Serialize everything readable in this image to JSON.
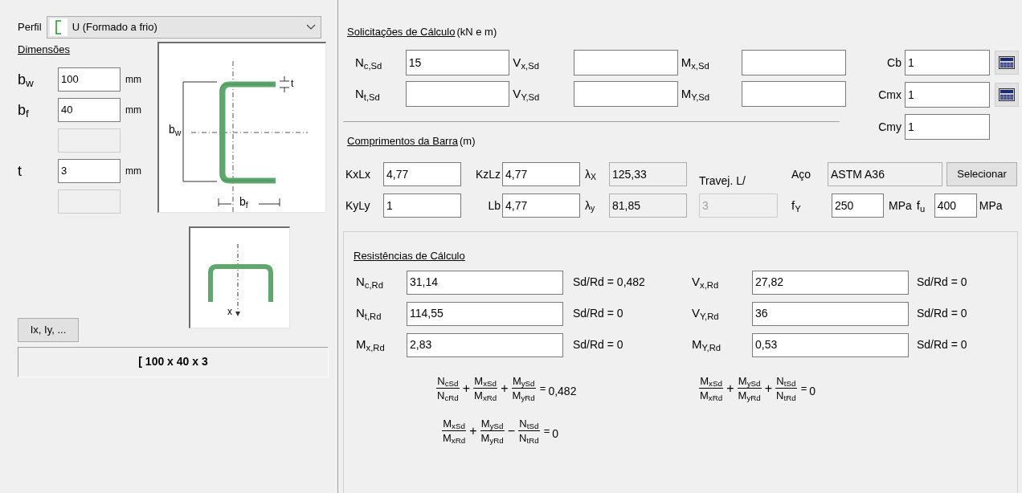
{
  "profile": {
    "label": "Perfil",
    "value": "U (Formado a frio)"
  },
  "dimensions": {
    "title": "Dimensões",
    "rows": [
      {
        "kind": "input",
        "label": "b$_{w}$",
        "value": "100",
        "unit": "mm"
      },
      {
        "kind": "input",
        "label": "b$_{f}$",
        "value": "40",
        "unit": "mm"
      },
      {
        "kind": "disabled"
      },
      {
        "kind": "input",
        "label": "t",
        "value": "3",
        "unit": "mm"
      },
      {
        "kind": "disabled"
      }
    ]
  },
  "section_drawing": {
    "web_label": "b$_{w}$",
    "flange_label": "b$_{f}$",
    "thickness_label": "t"
  },
  "axis_drawing": {
    "axis_label": "x"
  },
  "properties_button": "Ix, Iy, ...",
  "designation": "[ 100 x 40 x 3",
  "loads": {
    "title": "Solicitações de Cálculo",
    "unit_note": "(kN e m)",
    "rows": [
      [
        {
          "label": "N$_{c,Sd}$",
          "kind": "input",
          "value": "15"
        },
        {
          "label": "V$_{x,Sd}$",
          "kind": "input"
        },
        {
          "label": "M$_{x,Sd}$",
          "kind": "input"
        }
      ],
      [
        {
          "label": "N$_{t,Sd}$",
          "kind": "input"
        },
        {
          "label": "V$_{Y,Sd}$",
          "kind": "input"
        },
        {
          "label": "M$_{Y,Sd}$",
          "kind": "input"
        }
      ]
    ]
  },
  "coefficients": [
    {
      "label": "Cb",
      "kind": "input",
      "value": "1",
      "calculator": true
    },
    {
      "label": "Cmx",
      "kind": "input",
      "value": "1",
      "calculator": true
    },
    {
      "label": "Cmy",
      "kind": "input",
      "value": "1",
      "calculator": false
    }
  ],
  "lengths": {
    "title": "Comprimentos da Barra",
    "unit_note": "(m)",
    "rows": [
      [
        {
          "label": "KxLx",
          "kind": "input",
          "value": "4,77"
        },
        {
          "label": "KzLz",
          "kind": "input",
          "value": "4,77"
        },
        {
          "label": "λ$_{X}$",
          "kind": "readonly",
          "value": "125,33"
        }
      ],
      [
        {
          "label": "KyLy",
          "kind": "input",
          "value": "1"
        },
        {
          "label": "Lb",
          "kind": "input",
          "value": "4,77"
        },
        {
          "label": "λ$_{y}$",
          "kind": "readonly",
          "value": "81,85"
        }
      ]
    ],
    "bracing": {
      "label": "Travej. L/",
      "kind": "disabled",
      "value": "3"
    }
  },
  "material": {
    "steel_label": "Aço",
    "steel": {
      "kind": "readonly",
      "value": "ASTM A36"
    },
    "select_button": "Selecionar",
    "fy": {
      "label": "f$_{Y}$",
      "kind": "input",
      "value": "250",
      "unit": "MPa"
    },
    "fu": {
      "label": "f$_{u}$",
      "kind": "input",
      "value": "400",
      "unit": "MPa"
    }
  },
  "resistances": {
    "title": "Resistências de Cálculo",
    "rows": [
      [
        {
          "label": "N$_{c,Rd}$",
          "kind": "input",
          "value": "31,14",
          "ratio": "Sd/Rd = 0,482"
        },
        {
          "label": "V$_{x,Rd}$",
          "kind": "input",
          "value": "27,82",
          "ratio": "Sd/Rd = 0"
        }
      ],
      [
        {
          "label": "N$_{t,Rd}$",
          "kind": "input",
          "value": "114,55",
          "ratio": "Sd/Rd = 0"
        },
        {
          "label": "V$_{Y,Rd}$",
          "kind": "input",
          "value": "36",
          "ratio": "Sd/Rd = 0"
        }
      ],
      [
        {
          "label": "M$_{x,Rd}$",
          "kind": "input",
          "value": "2,83",
          "ratio": "Sd/Rd = 0"
        },
        {
          "label": "M$_{Y,Rd}$",
          "kind": "input",
          "value": "0,53",
          "ratio": "Sd/Rd = 0"
        }
      ]
    ]
  },
  "formulas": [
    {
      "terms": [
        {
          "num": "N$_{cSd}$",
          "den": "N$_{cRd}$"
        },
        {
          "num": "M$_{xSd}$",
          "den": "M$_{xRd}$"
        },
        {
          "num": "M$_{ySd}$",
          "den": "M$_{yRd}$"
        }
      ],
      "operators": [
        "+",
        "+"
      ],
      "equals": "=",
      "result": "0,482"
    },
    {
      "terms": [
        {
          "num": "M$_{xSd}$",
          "den": "M$_{xRd}$"
        },
        {
          "num": "M$_{ySd}$",
          "den": "M$_{yRd}$"
        },
        {
          "num": "N$_{tSd}$",
          "den": "N$_{tRd}$"
        }
      ],
      "operators": [
        "+",
        "+"
      ],
      "equals": "=",
      "result": "0"
    },
    {
      "terms": [
        {
          "num": "M$_{xSd}$",
          "den": "M$_{xRd}$"
        },
        {
          "num": "M$_{ySd}$",
          "den": "M$_{yRd}$"
        },
        {
          "num": "N$_{tSd}$",
          "den": "N$_{tRd}$"
        }
      ],
      "operators": [
        "+",
        "−"
      ],
      "equals": "=",
      "result": "0"
    }
  ]
}
